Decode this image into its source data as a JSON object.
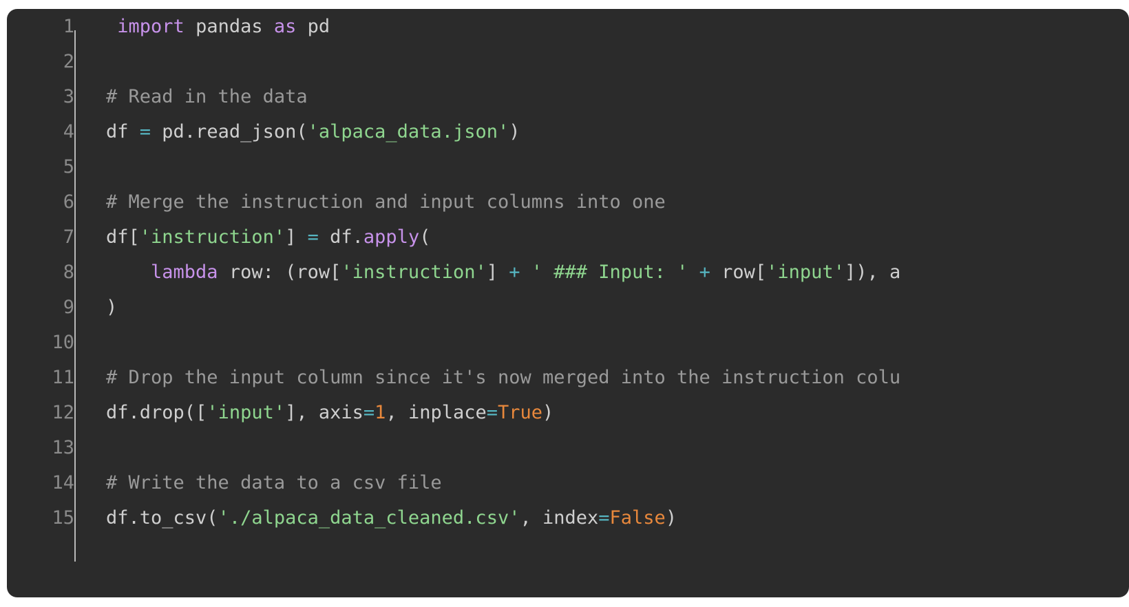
{
  "editor": {
    "language": "python",
    "background_color": "#2b2b2b",
    "page_background_color": "#ffffff",
    "line_number_color": "#8a8a8a",
    "palette": {
      "keyword": "#c792ea",
      "string": "#8fd68f",
      "operator": "#56b6c2",
      "literal": "#e8883c",
      "comment": "#9a9a9a",
      "plain": "#cfcfcf"
    },
    "first_line_number": 1,
    "last_line_number": 15,
    "total_lines": 15,
    "horizontally_clipped_lines": [
      8,
      11
    ]
  },
  "lines": [
    {
      "number": "1",
      "text": " import pandas as pd",
      "tokens": [
        {
          "t": " ",
          "c": "tok-txt"
        },
        {
          "t": "import",
          "c": "tok-kw"
        },
        {
          "t": " pandas ",
          "c": "tok-txt"
        },
        {
          "t": "as",
          "c": "tok-kw"
        },
        {
          "t": " pd",
          "c": "tok-txt"
        }
      ]
    },
    {
      "number": "2",
      "text": "",
      "tokens": []
    },
    {
      "number": "3",
      "text": "# Read in the data",
      "tokens": [
        {
          "t": "# Read in the data",
          "c": "tok-cmt"
        }
      ]
    },
    {
      "number": "4",
      "text": "df = pd.read_json('alpaca_data.json')",
      "tokens": [
        {
          "t": "df ",
          "c": "tok-txt"
        },
        {
          "t": "=",
          "c": "tok-op"
        },
        {
          "t": " pd.read_json(",
          "c": "tok-txt"
        },
        {
          "t": "'alpaca_data.json'",
          "c": "tok-str"
        },
        {
          "t": ")",
          "c": "tok-txt"
        }
      ]
    },
    {
      "number": "5",
      "text": "",
      "tokens": []
    },
    {
      "number": "6",
      "text": "# Merge the instruction and input columns into one",
      "tokens": [
        {
          "t": "# Merge the instruction and input columns into one",
          "c": "tok-cmt"
        }
      ]
    },
    {
      "number": "7",
      "text": "df['instruction'] = df.apply(",
      "tokens": [
        {
          "t": "df[",
          "c": "tok-txt"
        },
        {
          "t": "'instruction'",
          "c": "tok-str"
        },
        {
          "t": "] ",
          "c": "tok-txt"
        },
        {
          "t": "=",
          "c": "tok-op"
        },
        {
          "t": " df.",
          "c": "tok-txt"
        },
        {
          "t": "apply",
          "c": "tok-fn"
        },
        {
          "t": "(",
          "c": "tok-txt"
        }
      ]
    },
    {
      "number": "8",
      "text": "    lambda row: (row['instruction'] + ' ### Input: ' + row['input']), a",
      "tokens": [
        {
          "t": "    ",
          "c": "tok-txt"
        },
        {
          "t": "lambda",
          "c": "tok-kw"
        },
        {
          "t": " row: (row[",
          "c": "tok-txt"
        },
        {
          "t": "'instruction'",
          "c": "tok-str"
        },
        {
          "t": "] ",
          "c": "tok-txt"
        },
        {
          "t": "+",
          "c": "tok-op"
        },
        {
          "t": " ",
          "c": "tok-txt"
        },
        {
          "t": "' ### Input: '",
          "c": "tok-str"
        },
        {
          "t": " ",
          "c": "tok-txt"
        },
        {
          "t": "+",
          "c": "tok-op"
        },
        {
          "t": " row[",
          "c": "tok-txt"
        },
        {
          "t": "'input'",
          "c": "tok-str"
        },
        {
          "t": "]), a",
          "c": "tok-txt"
        }
      ]
    },
    {
      "number": "9",
      "text": ")",
      "tokens": [
        {
          "t": ")",
          "c": "tok-txt"
        }
      ]
    },
    {
      "number": "10",
      "text": "",
      "tokens": []
    },
    {
      "number": "11",
      "text": "# Drop the input column since it's now merged into the instruction colu",
      "tokens": [
        {
          "t": "# Drop the input column since it's now merged into the instruction colu",
          "c": "tok-cmt"
        }
      ]
    },
    {
      "number": "12",
      "text": "df.drop(['input'], axis=1, inplace=True)",
      "tokens": [
        {
          "t": "df.drop([",
          "c": "tok-txt"
        },
        {
          "t": "'input'",
          "c": "tok-str"
        },
        {
          "t": "], axis",
          "c": "tok-txt"
        },
        {
          "t": "=",
          "c": "tok-op"
        },
        {
          "t": "1",
          "c": "tok-num"
        },
        {
          "t": ", inplace",
          "c": "tok-txt"
        },
        {
          "t": "=",
          "c": "tok-op"
        },
        {
          "t": "True",
          "c": "tok-lit"
        },
        {
          "t": ")",
          "c": "tok-txt"
        }
      ]
    },
    {
      "number": "13",
      "text": "",
      "tokens": []
    },
    {
      "number": "14",
      "text": "# Write the data to a csv file",
      "tokens": [
        {
          "t": "# Write the data to a csv file",
          "c": "tok-cmt"
        }
      ]
    },
    {
      "number": "15",
      "text": "df.to_csv('./alpaca_data_cleaned.csv', index=False)",
      "tokens": [
        {
          "t": "df.to_csv(",
          "c": "tok-txt"
        },
        {
          "t": "'./alpaca_data_cleaned.csv'",
          "c": "tok-str"
        },
        {
          "t": ", index",
          "c": "tok-txt"
        },
        {
          "t": "=",
          "c": "tok-op"
        },
        {
          "t": "False",
          "c": "tok-lit"
        },
        {
          "t": ")",
          "c": "tok-txt"
        }
      ]
    }
  ]
}
